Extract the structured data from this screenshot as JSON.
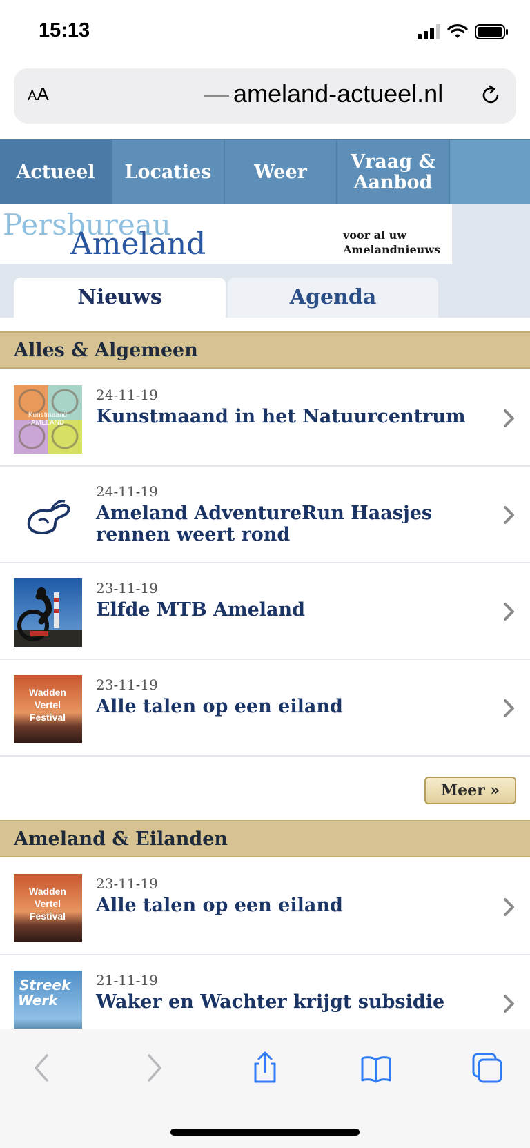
{
  "status": {
    "time": "15:13"
  },
  "browser": {
    "aa_label_small": "A",
    "aa_label_large": "A",
    "url_dash": "—",
    "url": "ameland-actueel.nl"
  },
  "nav": [
    {
      "label": "Actueel"
    },
    {
      "label": "Locaties"
    },
    {
      "label": "Weer"
    },
    {
      "label": "Vraag & Aanbod"
    }
  ],
  "banner": {
    "logo_line1": "Persbureau",
    "logo_line2": "Ameland",
    "tagline_1": "voor al uw",
    "tagline_2": "Amelandnieuws"
  },
  "tabs": [
    {
      "label": "Nieuws",
      "selected": true
    },
    {
      "label": "Agenda",
      "selected": false
    }
  ],
  "sections": [
    {
      "title": "Alles & Algemeen",
      "items": [
        {
          "date": "24-11-19",
          "title": "Kunstmaand in het Natuurcentrum",
          "thumb": "kunstmaand"
        },
        {
          "date": "24-11-19",
          "title": "Ameland AdventureRun Haasjes rennen weert rond",
          "thumb": "hare-logo"
        },
        {
          "date": "23-11-19",
          "title": "Elfde MTB Ameland",
          "thumb": "mtb-photo"
        },
        {
          "date": "23-11-19",
          "title": "Alle talen op een eiland",
          "thumb": "wadden-festival"
        }
      ],
      "more_label": "Meer »"
    },
    {
      "title": "Ameland & Eilanden",
      "items": [
        {
          "date": "23-11-19",
          "title": "Alle talen op een eiland",
          "thumb": "wadden-festival"
        },
        {
          "date": "21-11-19",
          "title": "Waker en Wachter krijgt subsidie",
          "thumb": "streekwerk"
        }
      ]
    }
  ],
  "thumb_text": {
    "kunstmaand_1": "Kunstmaand",
    "kunstmaand_2": "AMELAND",
    "wadden_1": "Wadden",
    "wadden_2": "Vertel",
    "wadden_3": "Festival",
    "streek_1": "Streek",
    "streek_2": "Werk"
  },
  "colors": {
    "nav_bg": "#5d8fb8",
    "section_header": "#d6c391",
    "title_blue": "#1b3466",
    "toolbar_blue": "#2f7cf6"
  },
  "toolbar_icons": [
    "back-icon",
    "forward-icon",
    "share-icon",
    "bookmarks-icon",
    "tabs-icon"
  ]
}
